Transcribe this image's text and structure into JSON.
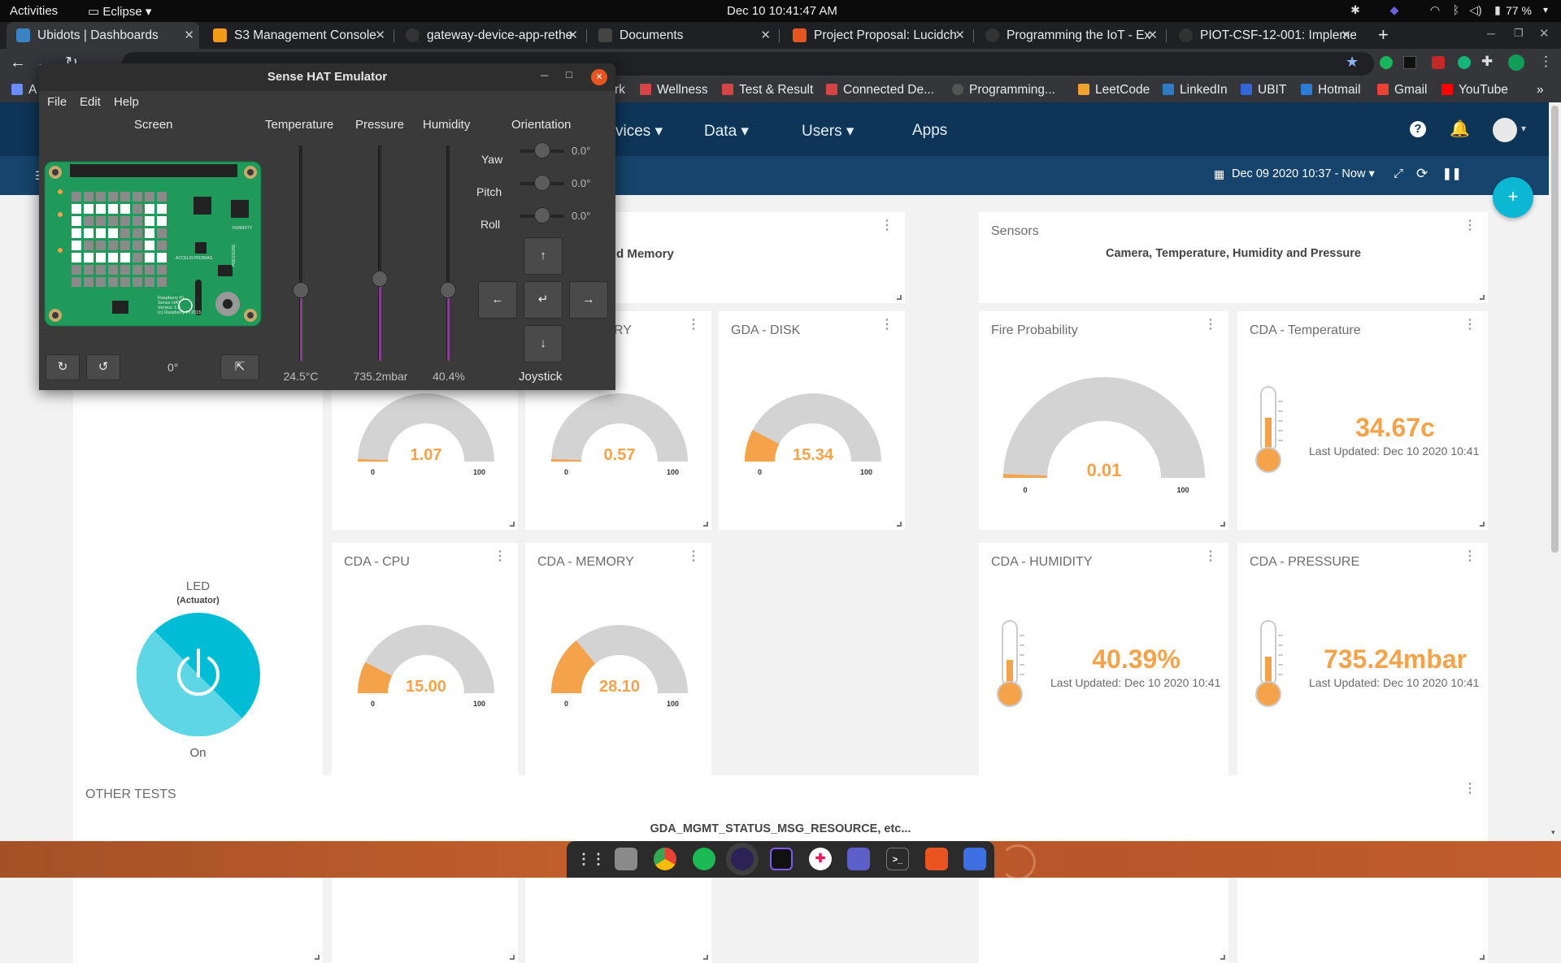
{
  "topbar": {
    "activities": "Activities",
    "app": "Eclipse",
    "clock": "Dec 10  10:41:47 AM",
    "battery": "77 %"
  },
  "browser": {
    "tabs": [
      {
        "label": "Ubidots | Dashboards",
        "active": true,
        "favicon_color": "#3b82c4"
      },
      {
        "label": "S3 Management Console",
        "active": false,
        "favicon_color": "#f39a1a"
      },
      {
        "label": "gateway-device-app-rethe",
        "active": false,
        "favicon_color": "#333333"
      },
      {
        "label": "Documents",
        "active": false,
        "favicon_color": "#444444"
      },
      {
        "label": "Project Proposal: Lucidch",
        "active": false,
        "favicon_color": "#e5551f"
      },
      {
        "label": "Programming the IoT - Ex",
        "active": false,
        "favicon_color": "#333333"
      },
      {
        "label": "PIOT-CSF-12-001: Impleme",
        "active": false,
        "favicon_color": "#333333"
      }
    ],
    "new_tab": "+",
    "bookmarks": [
      {
        "label": "A",
        "color": "#6b8cff"
      },
      {
        "label": "rk",
        "color": "#35363a"
      },
      {
        "label": "Wellness",
        "color": "#d64545"
      },
      {
        "label": "Test & Result",
        "color": "#d64545"
      },
      {
        "label": "Connected De...",
        "color": "#d64545"
      },
      {
        "label": "Programming...",
        "color": "#555555"
      },
      {
        "label": "LeetCode",
        "color": "#f0a22e"
      },
      {
        "label": "LinkedIn",
        "color": "#2f7bc4"
      },
      {
        "label": "UBIT",
        "color": "#3367d6"
      },
      {
        "label": "Hotmail",
        "color": "#2b7cd3"
      },
      {
        "label": "Gmail",
        "color": "#ea4335"
      },
      {
        "label": "YouTube",
        "color": "#ff0000"
      }
    ],
    "bookmarks_more": "»"
  },
  "ubidots": {
    "nav": [
      "vices",
      "Data",
      "Users",
      "Apps"
    ],
    "date_range": "Dec 09 2020 10:37 - Now",
    "add_button": "+"
  },
  "widgets": {
    "memory_partial": "d Memory",
    "ry_partial": "RY",
    "gda_disk": {
      "title": "GDA - DISK",
      "value": "15.34",
      "min": "0",
      "max": "100",
      "fraction": 0.1534
    },
    "gda_cpu_hidden": {
      "value": "1.07",
      "min": "0",
      "max": "100",
      "fraction": 0.0107
    },
    "gda_memory_hidden": {
      "value": "0.57",
      "min": "0",
      "max": "100",
      "fraction": 0.0057
    },
    "sensors": {
      "title": "Sensors",
      "text": "Camera, Temperature, Humidity and Pressure"
    },
    "fire": {
      "title": "Fire Probability",
      "value": "0.01",
      "min": "0",
      "max": "100",
      "fraction": 0.0001
    },
    "cda_temperature": {
      "title": "CDA - Temperature",
      "value": "34.67c",
      "updated": "Last Updated: Dec 10 2020 10:41"
    },
    "led": {
      "title": "LED",
      "subtitle": "(Actuator)",
      "state": "On"
    },
    "cda_cpu": {
      "title": "CDA - CPU",
      "value": "15.00",
      "min": "0",
      "max": "100",
      "fraction": 0.15
    },
    "cda_memory": {
      "title": "CDA - MEMORY",
      "value": "28.10",
      "min": "0",
      "max": "100",
      "fraction": 0.281
    },
    "cda_humidity": {
      "title": "CDA - HUMIDITY",
      "value": "40.39%",
      "updated": "Last Updated: Dec 10 2020 10:41"
    },
    "cda_pressure": {
      "title": "CDA - PRESSURE",
      "value": "735.24mbar",
      "updated": "Last Updated: Dec 10 2020 10:41"
    },
    "other_tests": {
      "title": "OTHER TESTS",
      "text": "GDA_MGMT_STATUS_MSG_RESOURCE, etc..."
    }
  },
  "sensehat": {
    "title": "Sense HAT Emulator",
    "menu": [
      "File",
      "Edit",
      "Help"
    ],
    "headers": {
      "screen": "Screen",
      "temperature": "Temperature",
      "pressure": "Pressure",
      "humidity": "Humidity",
      "orientation": "Orientation"
    },
    "temperature": "24.5°C",
    "pressure": "735.2mbar",
    "humidity": "40.4%",
    "temperature_level": 0.33,
    "pressure_level": 0.38,
    "humidity_level": 0.33,
    "rotation": "0°",
    "orientation": [
      {
        "label": "Yaw",
        "value": "0.0°"
      },
      {
        "label": "Pitch",
        "value": "0.0°"
      },
      {
        "label": "Roll",
        "value": "0.0°"
      }
    ],
    "joystick": {
      "label": "Joystick",
      "up": "↑",
      "down": "↓",
      "left": "←",
      "right": "→",
      "center": "↵"
    },
    "board_text": [
      "Raspberry Pi",
      "Sense HAT",
      "Version 1.0",
      "(c) Raspberry Pi 2015"
    ],
    "board_labels": {
      "accel": "ACCEL/GYRO/MAG",
      "humidity": "HUMIDITY",
      "pressure": "PRESSURE"
    }
  },
  "colors": {
    "accent": "#f5a34a",
    "navy": "#0d3557",
    "teal": "#00bcd4",
    "gauge_bg": "#d3d3d3",
    "board": "#1f9a5a"
  }
}
